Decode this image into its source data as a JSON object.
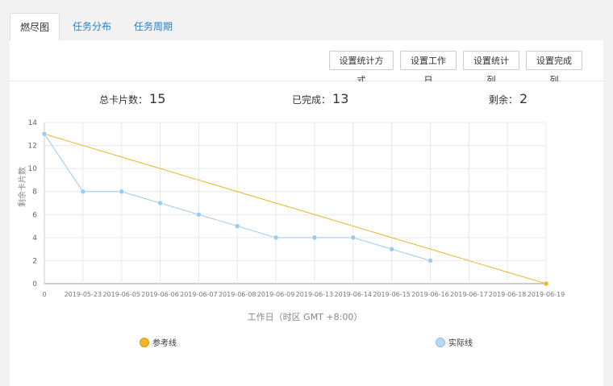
{
  "tabs": [
    {
      "label": "燃尽图",
      "active": true
    },
    {
      "label": "任务分布",
      "active": false
    },
    {
      "label": "任务周期",
      "active": false
    }
  ],
  "toolbar": {
    "buttons": [
      "设置统计方式",
      "设置工作日",
      "设置统计列",
      "设置完成列"
    ]
  },
  "stats": {
    "total_label": "总卡片数：",
    "total": "15",
    "done_label": "已完成：",
    "done": "13",
    "remain_label": "剩余：",
    "remain": "2"
  },
  "colors": {
    "reference": "#f0b429",
    "actual": "#9ccbf0",
    "link": "#2a7fc4"
  },
  "chart_data": {
    "type": "line",
    "categories": [
      "0",
      "2019-05-23",
      "2019-06-05",
      "2019-06-06",
      "2019-06-07",
      "2019-06-08",
      "2019-06-09",
      "2019-06-13",
      "2019-06-14",
      "2019-06-15",
      "2019-06-16",
      "2019-06-17",
      "2019-06-18",
      "2019-06-19"
    ],
    "series": [
      {
        "name": "参考线",
        "values": [
          13,
          12,
          11,
          10,
          9,
          8,
          7,
          6,
          5,
          4,
          3,
          2,
          1,
          0
        ]
      },
      {
        "name": "实际线",
        "values": [
          13,
          8,
          8,
          7,
          6,
          5,
          4,
          4,
          4,
          3,
          2,
          null,
          null,
          null
        ]
      }
    ],
    "xlabel": "工作日（时区 GMT +8:00）",
    "ylabel": "剩余卡片数",
    "ylim": [
      0,
      14
    ],
    "yticks": [
      0,
      2,
      4,
      6,
      8,
      10,
      12,
      14
    ],
    "grid": true,
    "legend": "bottom"
  }
}
